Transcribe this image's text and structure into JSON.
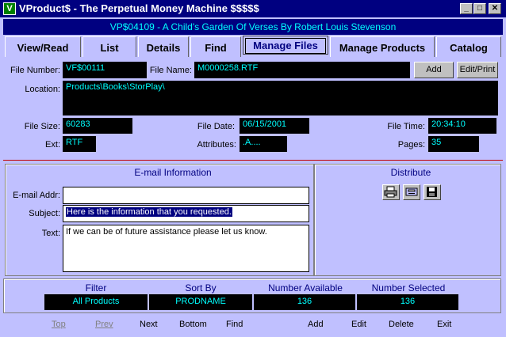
{
  "window": {
    "title": "VProduct$ - The Perpetual Money Machine $$$$$",
    "app_icon_glyph": "V"
  },
  "banner": "VP$04109 - A Child's Garden Of Verses By Robert Louis Stevenson",
  "tabs": [
    "View/Read",
    "List",
    "Details",
    "Find",
    "Manage Files",
    "Manage Products",
    "Catalog"
  ],
  "active_tab": "Manage Files",
  "file": {
    "number_label": "File Number:",
    "number": "VF$00111",
    "name_label": "File Name:",
    "name": "M0000258.RTF",
    "add_label": "Add",
    "editprint_label": "Edit/Print",
    "location_label": "Location:",
    "location": "Products\\Books\\StorPlay\\",
    "size_label": "File Size:",
    "size": "60283",
    "date_label": "File Date:",
    "date": "06/15/2001",
    "time_label": "File Time:",
    "time": "20:34:10",
    "ext_label": "Ext:",
    "ext": "RTF",
    "attributes_label": "Attributes:",
    "attributes": ".A....",
    "pages_label": "Pages:",
    "pages": "35"
  },
  "email": {
    "title": "E-mail Information",
    "addr_label": "E-mail Addr:",
    "addr": "",
    "subject_label": "Subject:",
    "subject": "Here is the information that you requested.",
    "text_label": "Text:",
    "text": "If we can be of future assistance please let us know."
  },
  "distribute": {
    "title": "Distribute",
    "icons": [
      "printer-icon",
      "fax-icon",
      "save-disk-icon"
    ]
  },
  "status": {
    "filter_label": "Filter",
    "filter": "All Products",
    "sortby_label": "Sort By",
    "sortby": "PRODNAME",
    "available_label": "Number Available",
    "available": "136",
    "selected_label": "Number Selected",
    "selected": "136"
  },
  "nav": {
    "top": "Top",
    "prev": "Prev",
    "next": "Next",
    "bottom": "Bottom",
    "find": "Find",
    "add": "Add",
    "edit": "Edit",
    "delete": "Delete",
    "exit": "Exit"
  },
  "colors": {
    "background": "#c0c0ff",
    "titlebar": "#000080",
    "field_bg": "#000000",
    "field_text": "#00ffff",
    "separator": "#c00000"
  }
}
